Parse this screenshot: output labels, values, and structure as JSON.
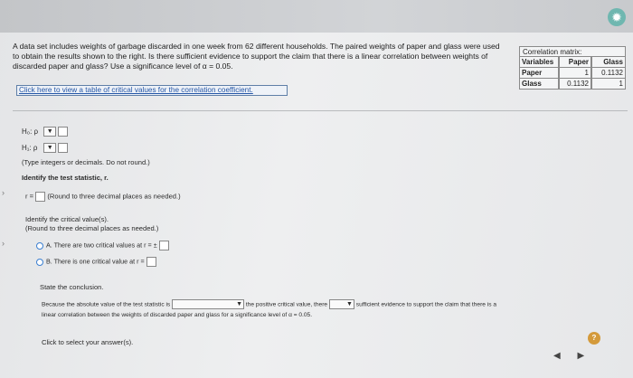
{
  "question": {
    "text": "A data set includes weights of garbage discarded in one week from 62 different households. The paired weights of paper and glass were used to obtain the results shown to the right. Is there sufficient evidence to support the claim that there is a linear correlation between weights of discarded paper and glass? Use a significance level of α = 0.05.",
    "link": "Click here to view a table of critical values for the correlation coefficient."
  },
  "matrix": {
    "title": "Correlation matrix:",
    "headers": [
      "Variables",
      "Paper",
      "Glass"
    ],
    "rows": [
      [
        "Paper",
        "1",
        "0.1132"
      ],
      [
        "Glass",
        "0.1132",
        "1"
      ]
    ]
  },
  "hypotheses": {
    "h0": "H₀: ρ",
    "h1": "H₁: ρ",
    "note": "(Type integers or decimals. Do not round.)"
  },
  "statistic": {
    "prompt": "Identify the test statistic, r.",
    "label": "r =",
    "note": "(Round to three decimal places as needed.)"
  },
  "critical": {
    "prompt": "Identify the critical value(s).",
    "note": "(Round to three decimal places as needed.)",
    "optionA": "A.  There are two critical values at r = ±",
    "optionB": "B.  There is one critical value at r ="
  },
  "conclusion": {
    "prompt": "State the conclusion.",
    "part1": "Because the absolute value of the test statistic is",
    "part2": "the positive critical value, there",
    "part3": "sufficient evidence to support the claim that there is a",
    "part4": "linear correlation between the weights of discarded paper and glass for a significance level of α = 0.05."
  },
  "footer": {
    "select_prompt": "Click to select your answer(s).",
    "help": "?",
    "nav": "◀ ▶"
  },
  "icons": {
    "settings": "gear-icon"
  }
}
